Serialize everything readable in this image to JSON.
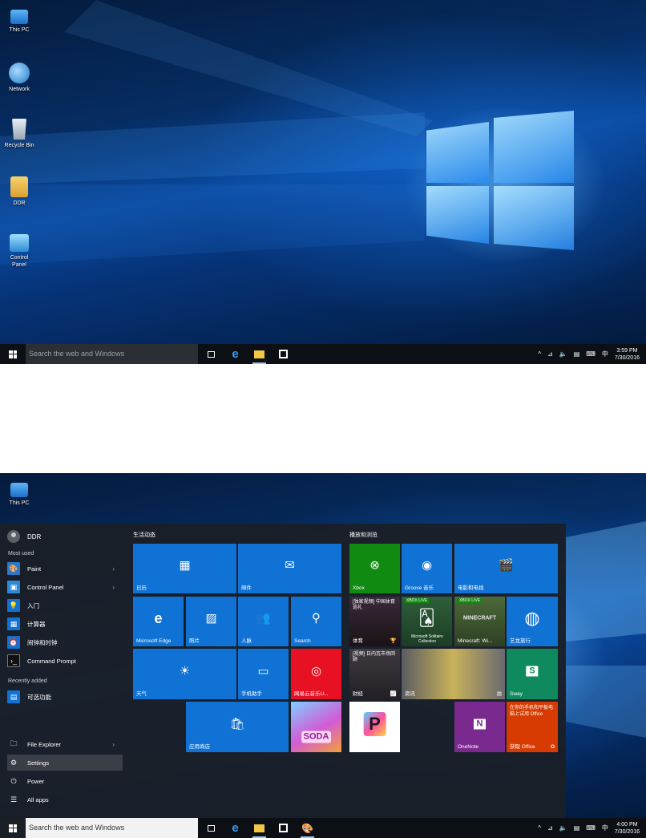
{
  "desktop_top": {
    "icons": [
      {
        "label": "This PC",
        "icon": "computer-icon"
      },
      {
        "label": "Network",
        "icon": "network-icon"
      },
      {
        "label": "Recycle Bin",
        "icon": "recycle-bin-icon"
      },
      {
        "label": "DDR",
        "icon": "user-folder-icon"
      },
      {
        "label": "Control Panel",
        "icon": "control-panel-icon"
      }
    ],
    "taskbar": {
      "search_placeholder": "Search the web and Windows",
      "time": "3:59 PM",
      "date": "7/30/2016",
      "ime": "中"
    }
  },
  "desktop_bottom": {
    "icons": [
      {
        "label": "This PC",
        "icon": "computer-icon"
      }
    ],
    "taskbar": {
      "search_placeholder": "Search the web and Windows",
      "time": "4:00 PM",
      "date": "7/30/2016",
      "ime": "中"
    },
    "start_menu": {
      "user_name": "DDR",
      "most_used_header": "Most used",
      "most_used": [
        {
          "label": "Paint",
          "icon": "paint-icon",
          "has_submenu": true
        },
        {
          "label": "Control Panel",
          "icon": "control-panel-icon",
          "has_submenu": true
        },
        {
          "label": "入门",
          "icon": "lightbulb-icon",
          "has_submenu": false
        },
        {
          "label": "计算器",
          "icon": "calculator-icon",
          "has_submenu": false
        },
        {
          "label": "闹钟和时钟",
          "icon": "alarm-icon",
          "has_submenu": false
        },
        {
          "label": "Command Prompt",
          "icon": "cmd-icon",
          "has_submenu": false
        }
      ],
      "recently_added_header": "Recently added",
      "recently_added": [
        {
          "label": "可选功能",
          "icon": "optional-features-icon"
        }
      ],
      "bottom": [
        {
          "label": "File Explorer",
          "icon": "file-explorer-icon",
          "has_submenu": true
        },
        {
          "label": "Settings",
          "icon": "gear-icon",
          "has_submenu": false
        },
        {
          "label": "Power",
          "icon": "power-icon",
          "has_submenu": false
        },
        {
          "label": "All apps",
          "icon": "all-apps-icon",
          "has_submenu": false
        }
      ],
      "group_left_title": "生活动态",
      "group_right_title": "播放和浏览",
      "tiles": [
        {
          "label": "日历",
          "icon": "calendar-icon",
          "glyph": "▦"
        },
        {
          "label": "邮件",
          "icon": "mail-icon",
          "glyph": "✉"
        },
        {
          "label": "Microsoft Edge",
          "icon": "edge-icon",
          "glyph": "e"
        },
        {
          "label": "照片",
          "icon": "photos-icon",
          "glyph": "▨"
        },
        {
          "label": "人脉",
          "icon": "people-icon",
          "glyph": "👥"
        },
        {
          "label": "Search",
          "icon": "search-icon",
          "glyph": "⚲"
        },
        {
          "label": "天气",
          "icon": "weather-icon",
          "glyph": "☀"
        },
        {
          "label": "手机助手",
          "icon": "phone-companion-icon",
          "glyph": "▭"
        },
        {
          "label": "网易云音乐U...",
          "icon": "netease-music-icon",
          "glyph": "◎"
        },
        {
          "label": "应用商店",
          "icon": "store-icon",
          "glyph": "🛍"
        },
        {
          "label": "Xbox",
          "icon": "xbox-icon",
          "glyph": "⊗"
        },
        {
          "label": "Groove 音乐",
          "icon": "groove-icon",
          "glyph": "◉"
        },
        {
          "label": "电影和电视",
          "icon": "movies-icon",
          "glyph": "🎬"
        },
        {
          "label": "体育",
          "icon": "sports-icon",
          "glyph": "🏆"
        },
        {
          "label": "Microsoft Solitaire Collection",
          "icon": "solitaire-icon",
          "glyph": "🂡"
        },
        {
          "label": "Minecraft: Wi...",
          "icon": "minecraft-icon",
          "glyph": "▩"
        },
        {
          "label": "艺龙旅行",
          "icon": "elong-icon",
          "glyph": "◍"
        },
        {
          "label": "财经",
          "icon": "finance-icon",
          "glyph": "📈"
        },
        {
          "label": "资讯",
          "icon": "news-icon",
          "glyph": "▤"
        },
        {
          "label": "Sway",
          "icon": "sway-icon",
          "glyph": "S"
        },
        {
          "label": "OneNote",
          "icon": "onenote-icon",
          "glyph": "N"
        },
        {
          "label": "获取 Office",
          "icon": "office-icon",
          "glyph": "O"
        },
        {
          "label": "Candy Crush Soda",
          "icon": "candy-crush-icon",
          "glyph": "SODA"
        },
        {
          "label": "PicsArt",
          "icon": "picsart-icon",
          "glyph": "P"
        }
      ],
      "xbox_live_badge": "XBOX LIVE",
      "sports_headline": "[独家视频] 中国体育巡礼",
      "finance_headline": "[视频] 日内瓦市场回顾",
      "office_promo": "在你的手机和平板电脑上试用 Office",
      "minecraft_art": "MINECRAFT"
    }
  }
}
